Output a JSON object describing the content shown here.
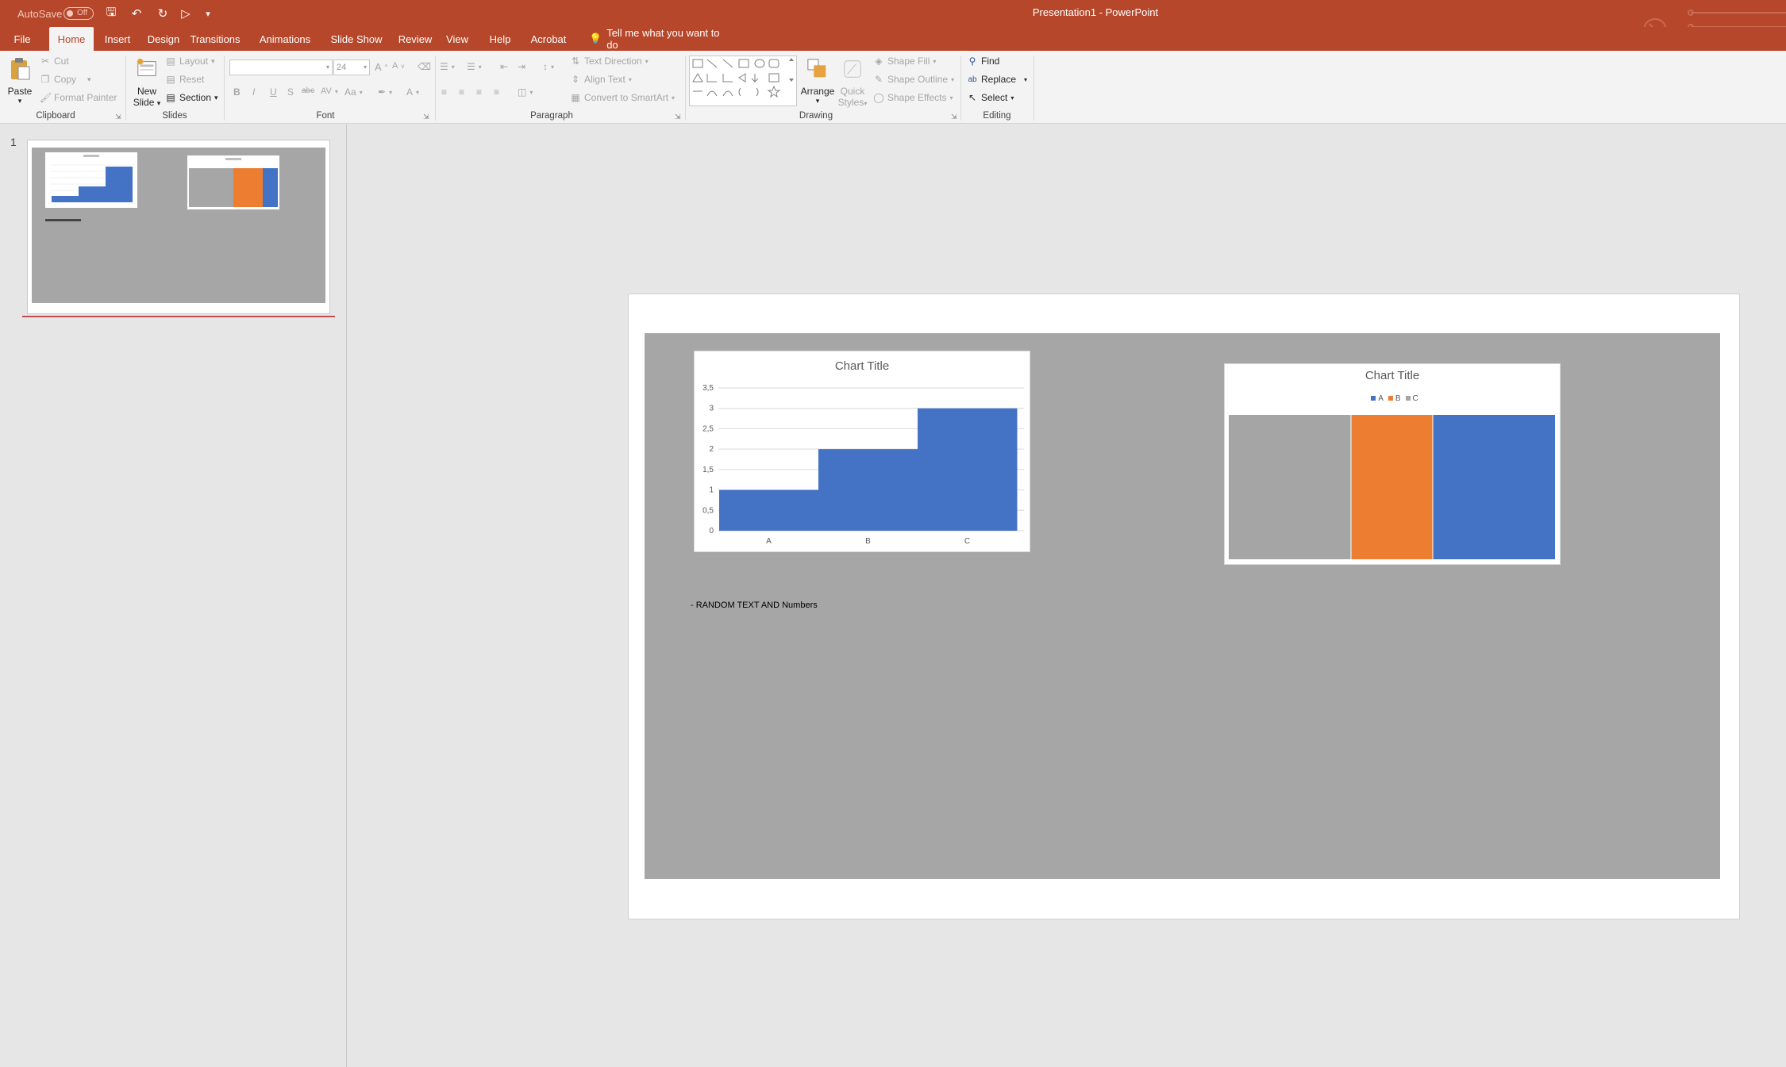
{
  "app": {
    "autosave_label": "AutoSave",
    "autosave_state": "Off",
    "document_title": "Presentation1  -  PowerPoint"
  },
  "tabs": [
    "File",
    "Home",
    "Insert",
    "Design",
    "Transitions",
    "Animations",
    "Slide Show",
    "Review",
    "View",
    "Help",
    "Acrobat"
  ],
  "active_tab": "Home",
  "tell_me": "Tell me what you want to do",
  "ribbon": {
    "clipboard": {
      "label": "Clipboard",
      "paste": "Paste",
      "cut": "Cut",
      "copy": "Copy",
      "format_painter": "Format Painter"
    },
    "slides": {
      "label": "Slides",
      "new_slide": "New",
      "new_slide_2": "Slide",
      "layout": "Layout",
      "reset": "Reset",
      "section": "Section"
    },
    "font": {
      "label": "Font",
      "font_name": "",
      "font_size": "24"
    },
    "paragraph": {
      "label": "Paragraph",
      "text_direction": "Text Direction",
      "align_text": "Align Text",
      "convert_smartart": "Convert to SmartArt"
    },
    "drawing": {
      "label": "Drawing",
      "arrange": "Arrange",
      "quick_styles": "Quick",
      "quick_styles_2": "Styles",
      "shape_fill": "Shape Fill",
      "shape_outline": "Shape Outline",
      "shape_effects": "Shape Effects"
    },
    "editing": {
      "label": "Editing",
      "find": "Find",
      "replace": "Replace",
      "select": "Select"
    }
  },
  "thumbnail": {
    "number": "1"
  },
  "slide": {
    "text": "- RANDOM TEXT AND Numbers"
  },
  "colors": {
    "accent_red": "#b7472a",
    "series_blue": "#4472c4",
    "series_orange": "#ed7d31",
    "series_gray": "#a5a5a5",
    "slide_background": "#a6a6a6"
  },
  "chart_data": [
    {
      "type": "area",
      "title": "Chart Title",
      "categories": [
        "A",
        "B",
        "C"
      ],
      "values": [
        1,
        2,
        3
      ],
      "y_ticks": [
        "0",
        "0,5",
        "1",
        "1,5",
        "2",
        "2,5",
        "3",
        "3,5"
      ],
      "ylim": [
        0,
        3.5
      ],
      "grid": true
    },
    {
      "type": "bar",
      "title": "Chart Title",
      "legend_position": "top",
      "series": [
        {
          "name": "A",
          "value": 3,
          "color": "#4472c4"
        },
        {
          "name": "B",
          "value": 2,
          "color": "#ed7d31"
        },
        {
          "name": "C",
          "value": 3,
          "color": "#a5a5a5"
        }
      ]
    }
  ]
}
